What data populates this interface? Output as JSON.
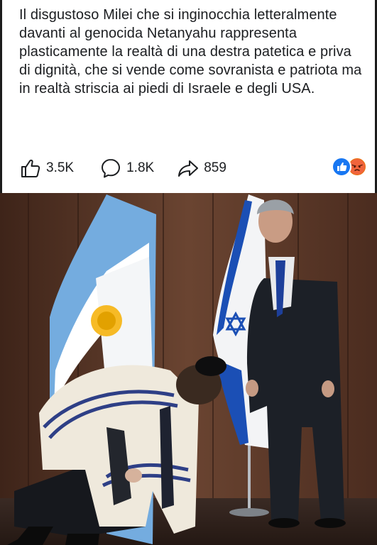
{
  "post": {
    "text": "Il disgustoso Milei che si inginocchia letteralmente davanti al genocida Netanyahu rappresenta plasticamente la realtà di una destra patetica e priva di dignità, che si vende come sovranista e patriota ma in realtà striscia ai piedi di Israele e degli USA."
  },
  "actions": {
    "like_count": "3.5K",
    "comment_count": "1.8K",
    "share_count": "859",
    "like_icon": "thumbs-up-icon",
    "comment_icon": "speech-bubble-icon",
    "share_icon": "share-arrow-icon"
  },
  "reactions": {
    "items": [
      "like-reaction-icon",
      "angry-reaction-icon"
    ],
    "colors": {
      "like": "#1877f2",
      "angry": "#e9710f"
    }
  },
  "photo": {
    "subject": "news-photo"
  }
}
